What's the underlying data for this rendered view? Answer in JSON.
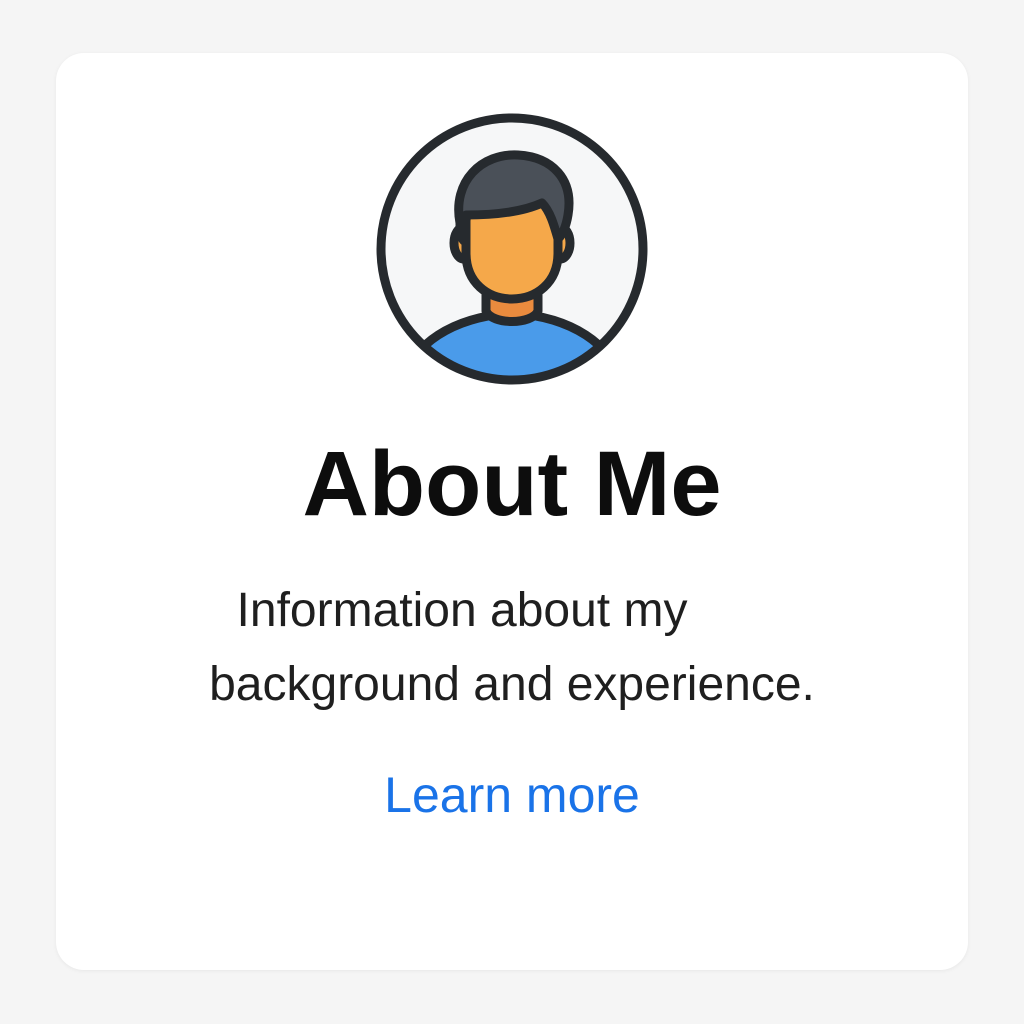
{
  "card": {
    "title": "About Me",
    "description_line1": "Information about my",
    "description_line2": "background and experience.",
    "link_label": "Learn more"
  },
  "icons": {
    "avatar": "user-avatar-icon"
  },
  "colors": {
    "page_background": "#f5f5f5",
    "card_background": "#ffffff",
    "link": "#1a73e8",
    "avatar_skin": "#f5a84a",
    "avatar_shirt": "#4a9bea",
    "avatar_hair": "#4a5058",
    "avatar_outline": "#262a2e"
  }
}
